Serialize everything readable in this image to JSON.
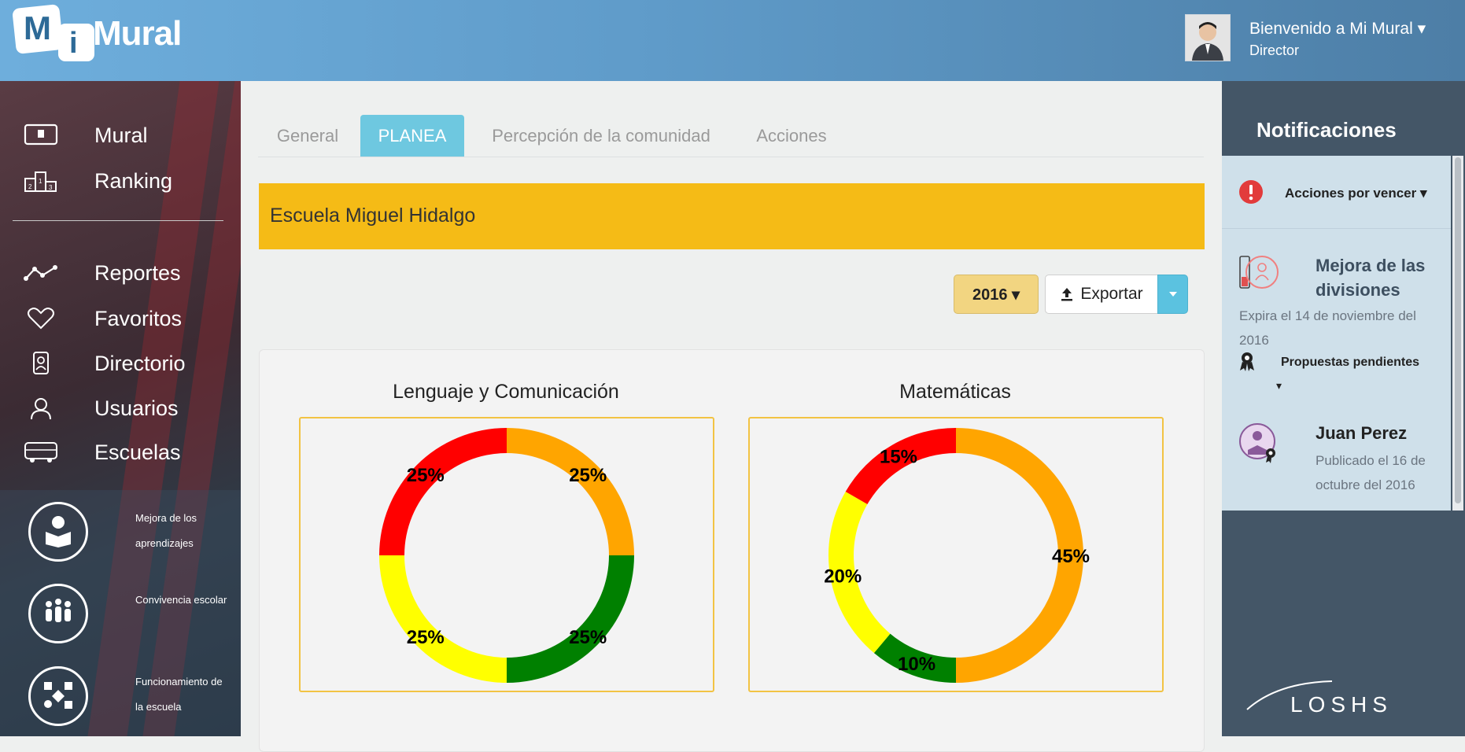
{
  "header": {
    "logo_text": "Mural",
    "logo_letters": [
      "M",
      "i"
    ],
    "welcome": "Bienvenido a Mi Mural ▾",
    "role": "Director"
  },
  "sidebar": {
    "items": [
      {
        "label": "Mural",
        "icon": "mural-icon"
      },
      {
        "label": "Ranking",
        "icon": "ranking-icon"
      },
      {
        "label": "Reportes",
        "icon": "reportes-icon"
      },
      {
        "label": "Favoritos",
        "icon": "heart-icon"
      },
      {
        "label": "Directorio",
        "icon": "directory-icon"
      },
      {
        "label": "Usuarios",
        "icon": "user-icon"
      },
      {
        "label": "Escuelas",
        "icon": "bus-icon"
      }
    ],
    "circle_items": [
      {
        "label": "Mejora de los aprendizajes",
        "icon": "reader-icon"
      },
      {
        "label": "Convivencia escolar",
        "icon": "people-icon"
      },
      {
        "label": "Funcionamiento de la escuela",
        "icon": "process-icon"
      }
    ]
  },
  "tabs": [
    {
      "label": "General",
      "active": false
    },
    {
      "label": "PLANEA",
      "active": true
    },
    {
      "label": "Percepción de la comunidad",
      "active": false
    },
    {
      "label": "Acciones",
      "active": false
    }
  ],
  "school": {
    "name": "Escuela Miguel Hidalgo"
  },
  "toolbar": {
    "year": "2016 ▾",
    "export_label": "Exportar"
  },
  "chart_data": [
    {
      "type": "pie",
      "title": "Lenguaje y Comunicación",
      "categories": [
        "orange",
        "green",
        "yellow",
        "red"
      ],
      "values": [
        25,
        25,
        25,
        25
      ],
      "labels": [
        "25%",
        "25%",
        "25%",
        "25%"
      ],
      "colors": [
        "#ffa500",
        "#008000",
        "#ffff00",
        "#ff0000"
      ]
    },
    {
      "type": "pie",
      "title": "Matemáticas",
      "categories": [
        "orange",
        "green",
        "yellow",
        "red"
      ],
      "values": [
        45,
        10,
        20,
        15
      ],
      "labels": [
        "45%",
        "10%",
        "20%",
        "15%"
      ],
      "colors": [
        "#ffa500",
        "#008000",
        "#ffff00",
        "#ff0000"
      ]
    }
  ],
  "notifications": {
    "title": "Notificaciones",
    "filter": "Acciones por vencer ▾",
    "items": [
      {
        "title": "Mejora de las divisiones",
        "subtitle": "Expira el 14 de noviembre del 2016",
        "extra": "Propuestas pendientes",
        "extra_caret": "▾"
      },
      {
        "title": "Juan Perez",
        "subtitle": "Publicado el 16 de octubre del 2016"
      }
    ]
  },
  "brand": {
    "footer_logo": "LOSHS"
  },
  "colors": {
    "accent_tab": "#6ec8e0",
    "school_bar": "#f5bb16",
    "right_panel": "#445667"
  }
}
